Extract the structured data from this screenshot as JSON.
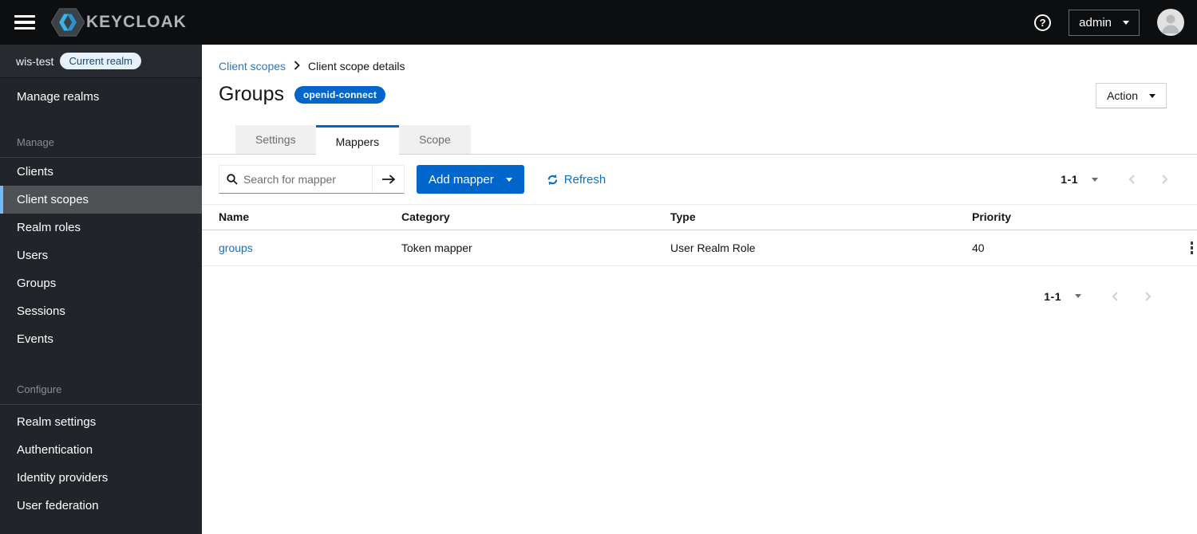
{
  "masthead": {
    "brand_text": "KEYCLOAK",
    "username": "admin"
  },
  "sidebar": {
    "realm_name": "wis-test",
    "realm_badge": "Current realm",
    "manage_realms_label": "Manage realms",
    "sections": [
      {
        "label": "Manage",
        "items": [
          {
            "label": "Clients"
          },
          {
            "label": "Client scopes"
          },
          {
            "label": "Realm roles"
          },
          {
            "label": "Users"
          },
          {
            "label": "Groups"
          },
          {
            "label": "Sessions"
          },
          {
            "label": "Events"
          }
        ]
      },
      {
        "label": "Configure",
        "items": [
          {
            "label": "Realm settings"
          },
          {
            "label": "Authentication"
          },
          {
            "label": "Identity providers"
          },
          {
            "label": "User federation"
          }
        ]
      }
    ]
  },
  "breadcrumb": {
    "link": "Client scopes",
    "current": "Client scope details"
  },
  "page": {
    "title": "Groups",
    "protocol_badge": "openid-connect",
    "action_button": "Action"
  },
  "tabs": {
    "settings": "Settings",
    "mappers": "Mappers",
    "scope": "Scope"
  },
  "toolbar": {
    "search_placeholder": "Search for mapper",
    "search_value": "",
    "add_mapper_button": "Add mapper",
    "refresh_label": "Refresh"
  },
  "pagination": {
    "top_range": "1-1",
    "bottom_range": "1-1"
  },
  "table": {
    "headers": {
      "name": "Name",
      "category": "Category",
      "type": "Type",
      "priority": "Priority"
    },
    "rows": [
      {
        "name": "groups",
        "category": "Token mapper",
        "type": "User Realm Role",
        "priority": "40"
      }
    ]
  },
  "colors": {
    "primary": "#0066cc",
    "link": "#0f6fc5",
    "masthead_bg": "#0c0e10",
    "sidebar_bg": "#212529",
    "nav_current_bg": "#4f5255",
    "nav_accent": "#73bcf7",
    "badge_bg": "#e7f1fa"
  }
}
